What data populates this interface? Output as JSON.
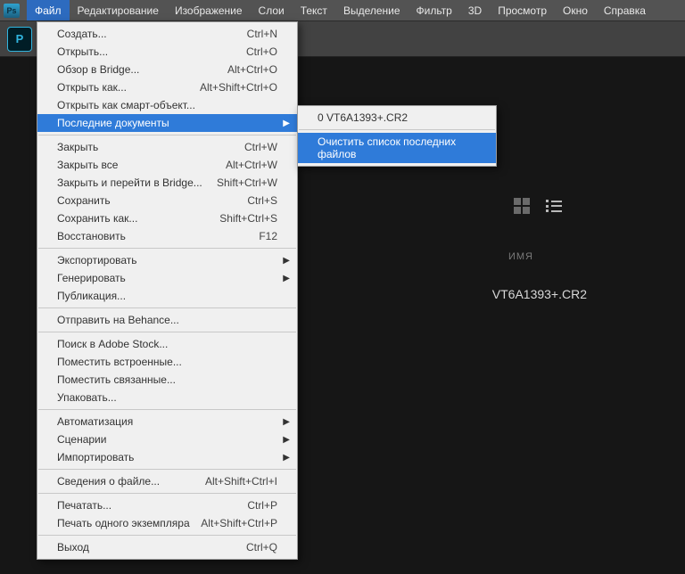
{
  "menubar": {
    "items": [
      "Файл",
      "Редактирование",
      "Изображение",
      "Слои",
      "Текст",
      "Выделение",
      "Фильтр",
      "3D",
      "Просмотр",
      "Окно",
      "Справка"
    ],
    "activeIndex": 0
  },
  "psBadge": "Ps",
  "psLogo": "P",
  "rightPanel": {
    "nameLabel": "ИМЯ",
    "fileName": "VT6A1393+.CR2"
  },
  "fileMenu": {
    "groups": [
      [
        {
          "label": "Создать...",
          "shortcut": "Ctrl+N"
        },
        {
          "label": "Открыть...",
          "shortcut": "Ctrl+O"
        },
        {
          "label": "Обзор в Bridge...",
          "shortcut": "Alt+Ctrl+O"
        },
        {
          "label": "Открыть как...",
          "shortcut": "Alt+Shift+Ctrl+O"
        },
        {
          "label": "Открыть как смарт-объект...",
          "shortcut": ""
        },
        {
          "label": "Последние документы",
          "shortcut": "",
          "submenu": true,
          "highlight": true
        }
      ],
      [
        {
          "label": "Закрыть",
          "shortcut": "Ctrl+W"
        },
        {
          "label": "Закрыть все",
          "shortcut": "Alt+Ctrl+W"
        },
        {
          "label": "Закрыть и перейти в Bridge...",
          "shortcut": "Shift+Ctrl+W"
        },
        {
          "label": "Сохранить",
          "shortcut": "Ctrl+S"
        },
        {
          "label": "Сохранить как...",
          "shortcut": "Shift+Ctrl+S"
        },
        {
          "label": "Восстановить",
          "shortcut": "F12"
        }
      ],
      [
        {
          "label": "Экспортировать",
          "shortcut": "",
          "submenu": true
        },
        {
          "label": "Генерировать",
          "shortcut": "",
          "submenu": true
        },
        {
          "label": "Публикация...",
          "shortcut": ""
        }
      ],
      [
        {
          "label": "Отправить на Behance...",
          "shortcut": ""
        }
      ],
      [
        {
          "label": "Поиск в Adobe Stock...",
          "shortcut": ""
        },
        {
          "label": "Поместить встроенные...",
          "shortcut": ""
        },
        {
          "label": "Поместить связанные...",
          "shortcut": ""
        },
        {
          "label": "Упаковать...",
          "shortcut": ""
        }
      ],
      [
        {
          "label": "Автоматизация",
          "shortcut": "",
          "submenu": true
        },
        {
          "label": "Сценарии",
          "shortcut": "",
          "submenu": true
        },
        {
          "label": "Импортировать",
          "shortcut": "",
          "submenu": true
        }
      ],
      [
        {
          "label": "Сведения о файле...",
          "shortcut": "Alt+Shift+Ctrl+I"
        }
      ],
      [
        {
          "label": "Печатать...",
          "shortcut": "Ctrl+P"
        },
        {
          "label": "Печать одного экземпляра",
          "shortcut": "Alt+Shift+Ctrl+P"
        }
      ],
      [
        {
          "label": "Выход",
          "shortcut": "Ctrl+Q"
        }
      ]
    ]
  },
  "recentSubmenu": {
    "items": [
      {
        "label": "0  VT6A1393+.CR2",
        "highlight": false
      },
      {
        "label": "Очистить список последних файлов",
        "highlight": true
      }
    ]
  }
}
